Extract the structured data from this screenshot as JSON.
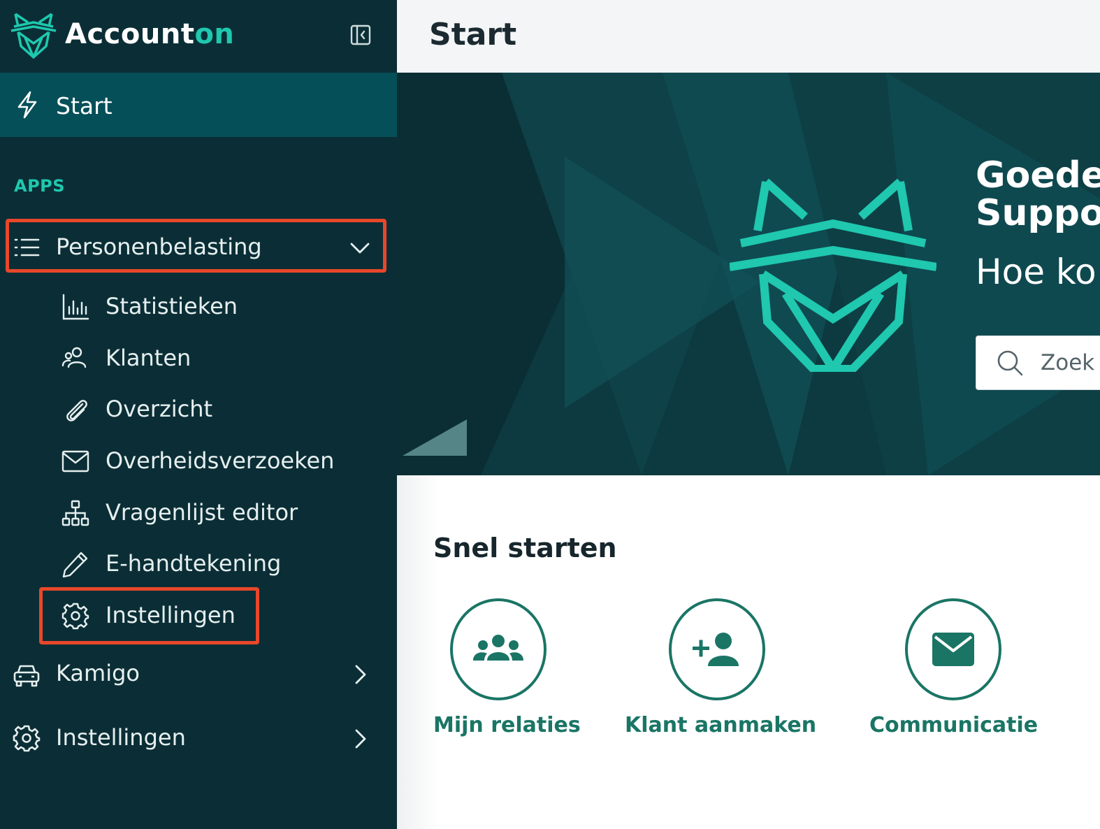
{
  "brand": {
    "name_main": "Account",
    "name_accent": "on"
  },
  "colors": {
    "sidebar_bg": "#0b2e36",
    "active_bg": "#054f58",
    "accent": "#1fc8ae",
    "highlight": "#e8472a",
    "quick_green": "#1a7565"
  },
  "sidebar": {
    "start_label": "Start",
    "section_label": "APPS",
    "personenbelasting": {
      "label": "Personenbelasting",
      "children": [
        {
          "label": "Statistieken",
          "icon": "bar-chart-icon"
        },
        {
          "label": "Klanten",
          "icon": "users-icon"
        },
        {
          "label": "Overzicht",
          "icon": "paperclip-icon"
        },
        {
          "label": "Overheidsverzoeken",
          "icon": "envelope-icon"
        },
        {
          "label": "Vragenlijst editor",
          "icon": "sitemap-icon"
        },
        {
          "label": "E-handtekening",
          "icon": "pencil-icon"
        },
        {
          "label": "Instellingen",
          "icon": "gear-icon"
        }
      ]
    },
    "kamigo": {
      "label": "Kamigo",
      "icon": "car-icon"
    },
    "instellingen": {
      "label": "Instellingen",
      "icon": "gear-icon"
    }
  },
  "header": {
    "title": "Start"
  },
  "hero": {
    "line1": "Goede",
    "line2": "Suppo",
    "line3": "Hoe ko",
    "search_placeholder": "Zoek"
  },
  "quick_start": {
    "title": "Snel starten",
    "items": [
      {
        "label": "Mijn relaties",
        "icon": "group-icon"
      },
      {
        "label": "Klant aanmaken",
        "icon": "user-plus-icon"
      },
      {
        "label": "Communicatie",
        "icon": "mail-icon"
      }
    ]
  }
}
